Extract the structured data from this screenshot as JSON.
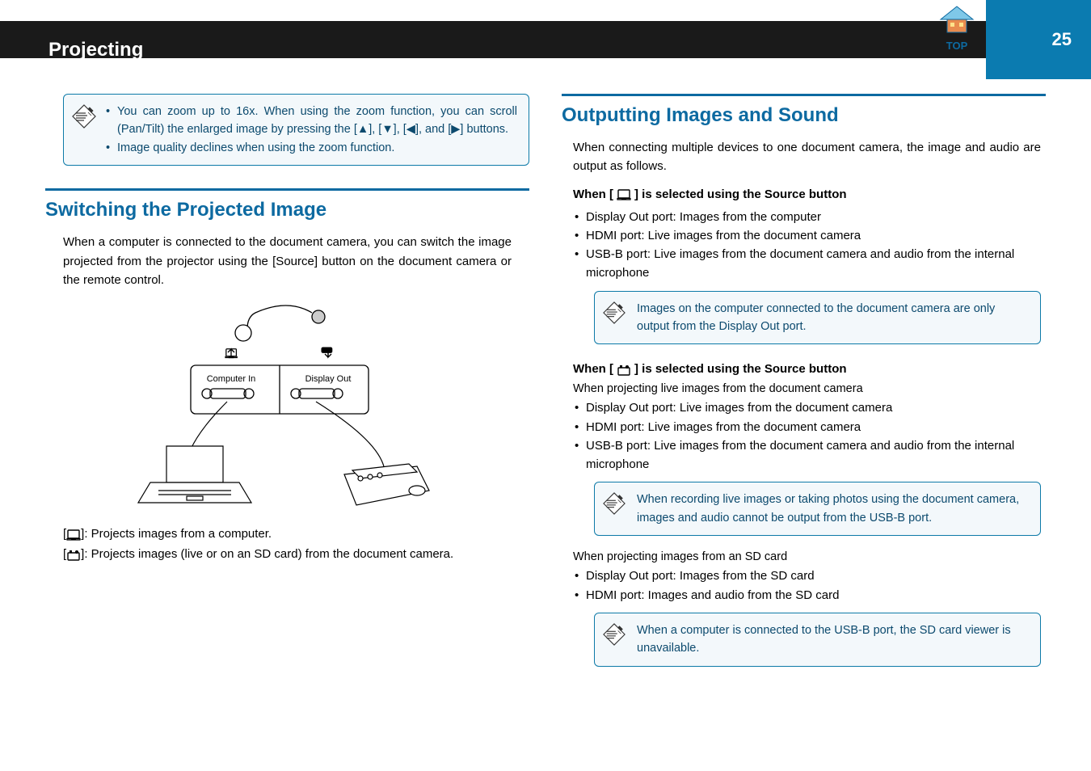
{
  "header": {
    "title": "Projecting",
    "page_number": "25",
    "top_label": "TOP"
  },
  "left": {
    "note1": {
      "items": [
        "You can zoom up to 16x. When using the zoom function, you can scroll (Pan/Tilt) the enlarged image by pressing the [▲], [▼], [◀], and [▶] buttons.",
        "Image quality declines when using the zoom function."
      ]
    },
    "h2_switch": "Switching the Projected Image",
    "switch_intro": "When a computer is connected to the document camera, you can switch the image projected from the projector using the [Source] button on the document camera or the remote control.",
    "diagram": {
      "computer_in": "Computer In",
      "display_out": "Display Out"
    },
    "def1_pre": "[",
    "def1_post": "]: Projects images from a computer.",
    "def2_pre": "[",
    "def2_post": "]: Projects images (live or on an SD card) from the document camera."
  },
  "right": {
    "h2_output": "Outputting Images and Sound",
    "output_intro": "When connecting multiple devices to one document camera, the image and audio are output as follows.",
    "sub1_pre": "When [",
    "sub1_post": "] is selected using the Source button",
    "sub1_bullets": [
      "Display Out port: Images from the computer",
      "HDMI port: Live images from the document camera",
      "USB-B port: Live images from the document camera and audio from the internal microphone"
    ],
    "note2": "Images on the computer connected to the document camera are only output from the Display Out port.",
    "sub2_pre": "When [",
    "sub2_post": "] is selected using the Source button",
    "sub2_intro": "When projecting live images from the document camera",
    "sub2_bullets": [
      "Display Out port: Live images from the document camera",
      "HDMI port: Live images from the document camera",
      "USB-B port: Live images from the document camera and audio from the internal microphone"
    ],
    "note3": "When recording live images or taking photos using the document camera, images and audio cannot be output from the USB-B port.",
    "sd_intro": "When projecting images from an SD card",
    "sd_bullets": [
      "Display Out port: Images from the SD card",
      "HDMI port: Images and audio from the SD card"
    ],
    "note4": "When a computer is connected to the USB-B port, the SD card viewer is unavailable."
  }
}
